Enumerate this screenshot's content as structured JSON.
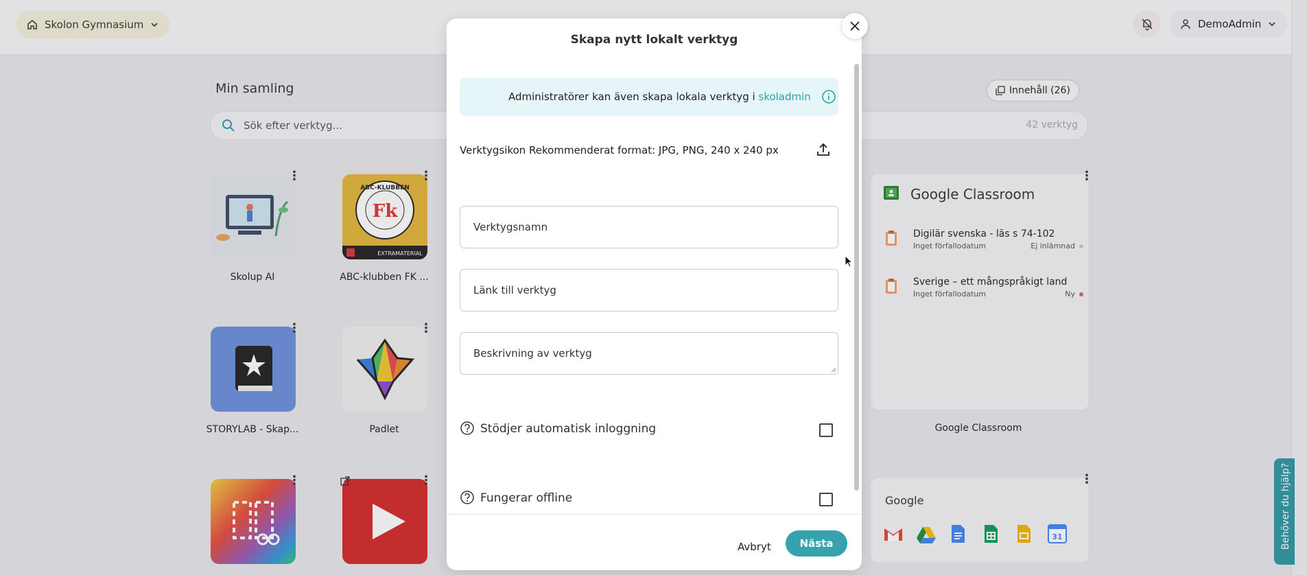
{
  "topbar": {
    "school_label": "Skolon Gymnasium",
    "user_label": "DemoAdmin"
  },
  "background": {
    "collection_title": "Min samling",
    "content_button": "Innehåll (26)",
    "search": {
      "placeholder": "Sök efter verktyg...",
      "count": "42 verktyg"
    },
    "tiles": [
      {
        "label": "Skolup AI"
      },
      {
        "label": "ABC-klubben FK ...",
        "logo_text": "Fk",
        "ring_text": "ABC-KLUBBEN",
        "badge": "EXTRAMATERIAL"
      },
      {
        "label": "STORYLAB - Skap..."
      },
      {
        "label": "Padlet"
      },
      {
        "label": ""
      },
      {
        "label": ""
      }
    ],
    "google_classroom": {
      "title": "Google Classroom",
      "label": "Google Classroom",
      "assignments": [
        {
          "title": "Digilär svenska - läs s 74-102",
          "due": "Inget förfallodatum",
          "status": "Ej inlämnad",
          "dot_color": "#c8c8c8"
        },
        {
          "title": "Sverige – ett mångspråkigt land",
          "due": "Inget förfallodatum",
          "status": "Ny",
          "dot_color": "#e05a6a"
        }
      ]
    },
    "google_card": {
      "title": "Google",
      "icons": [
        "gmail-icon",
        "drive-icon",
        "docs-icon",
        "sheets-icon",
        "slides-icon",
        "calendar-icon"
      ],
      "calendar_day": "31"
    }
  },
  "modal": {
    "title": "Skapa nytt lokalt verktyg",
    "info_text": "Administratörer kan även skapa lokala verktyg i ",
    "info_link": "skoladmin",
    "icon_label": "Verktygsikon Rekommenderat format: JPG, PNG, 240 x 240 px",
    "fields": {
      "name": "Verktygsnamn",
      "link": "Länk till verktyg",
      "description": "Beskrivning av verktyg"
    },
    "checkboxes": {
      "auto_login": {
        "label": "Stödjer automatisk inloggning",
        "checked": false
      },
      "offline": {
        "label": "Fungerar offline",
        "checked": false
      }
    },
    "cancel_label": "Avbryt",
    "next_label": "Nästa"
  },
  "help_tab": "Behöver du hjälp?",
  "colors": {
    "accent": "#35a2ae",
    "info_bg": "#e6f5f7",
    "link": "#2aa0ad"
  }
}
